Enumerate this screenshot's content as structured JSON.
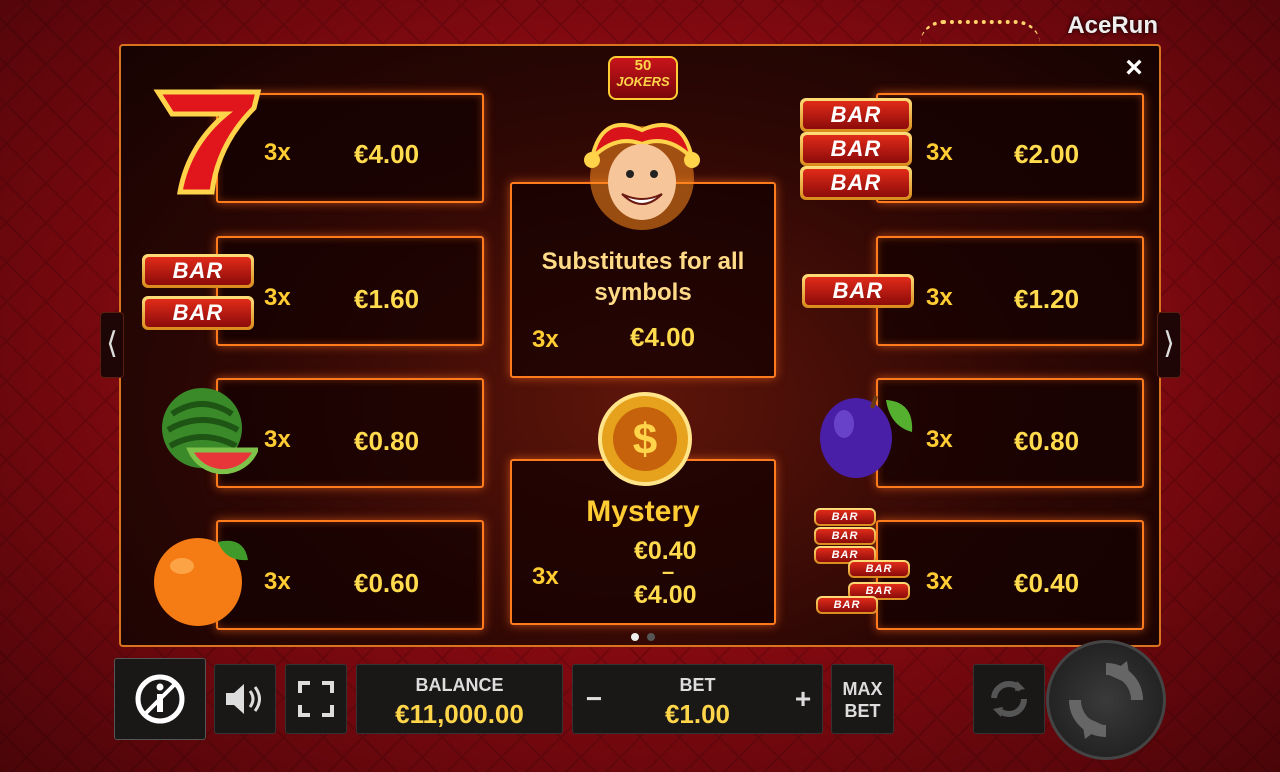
{
  "brand": {
    "logo": "AceRun"
  },
  "game_logo": {
    "line1": "50",
    "line2": "JOKERS"
  },
  "paytable": {
    "left": [
      {
        "symbol": "seven-icon",
        "mult": "3x",
        "value": "€4.00"
      },
      {
        "symbol": "double-bar-icon",
        "mult": "3x",
        "value": "€1.60"
      },
      {
        "symbol": "watermelon-icon",
        "mult": "3x",
        "value": "€0.80"
      },
      {
        "symbol": "orange-icon",
        "mult": "3x",
        "value": "€0.60"
      }
    ],
    "right": [
      {
        "symbol": "triple-bar-icon",
        "mult": "3x",
        "value": "€2.00"
      },
      {
        "symbol": "single-bar-icon",
        "mult": "3x",
        "value": "€1.20"
      },
      {
        "symbol": "plum-icon",
        "mult": "3x",
        "value": "€0.80"
      },
      {
        "symbol": "mixed-bar-icon",
        "mult": "3x",
        "value": "€0.40"
      }
    ],
    "bar_text": "BAR",
    "joker": {
      "description": "Substitutes for all symbols",
      "mult": "3x",
      "value": "€4.00"
    },
    "mystery": {
      "title": "Mystery",
      "mult": "3x",
      "value_min": "€0.40",
      "dash": "–",
      "value_max": "€4.00"
    }
  },
  "controls": {
    "close": "×",
    "nav_left": "⟨",
    "nav_right": "⟩",
    "balance_label": "BALANCE",
    "balance_value": "€11,000.00",
    "bet_label": "BET",
    "bet_value": "€1.00",
    "bet_minus": "−",
    "bet_plus": "+",
    "maxbet_line1": "MAX",
    "maxbet_line2": "BET"
  },
  "colors": {
    "accent": "#ff7b1e",
    "gold": "#ffdb4d",
    "panel_bg": "#2d0704"
  }
}
